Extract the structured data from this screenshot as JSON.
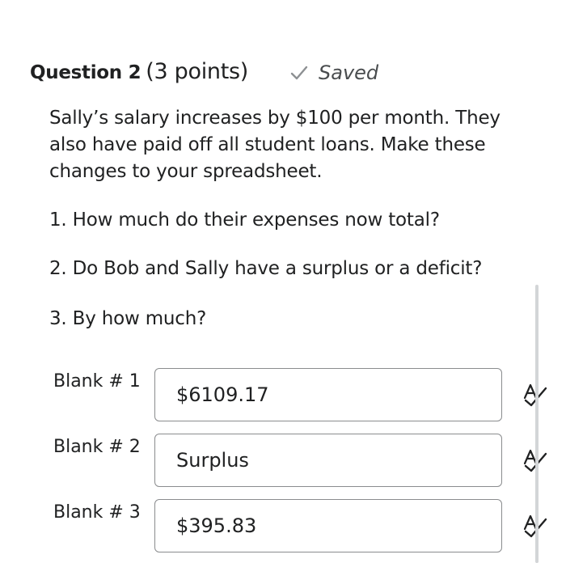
{
  "question": {
    "title": "Question 2",
    "points": "(3 points)",
    "status": "Saved",
    "body": "Sally’s salary increases by $100 per month. They also have paid off all student loans. Make these changes to your spreadsheet.",
    "sub_questions": [
      "1. How much do their expenses now total?",
      "2. Do Bob and Sally have a surplus or a deficit?",
      "3. By how much?"
    ]
  },
  "blanks": [
    {
      "label": "Blank # 1",
      "value": "$6109.17"
    },
    {
      "label": "Blank # 2",
      "value": "Surplus"
    },
    {
      "label": "Blank # 3",
      "value": "$395.83"
    }
  ],
  "icons": {
    "saved_status": "check-icon",
    "answer_tools": "spell-check-icon"
  },
  "colors": {
    "text": "#202122",
    "muted": "#6e7376",
    "input_border": "#8a8c8e"
  }
}
